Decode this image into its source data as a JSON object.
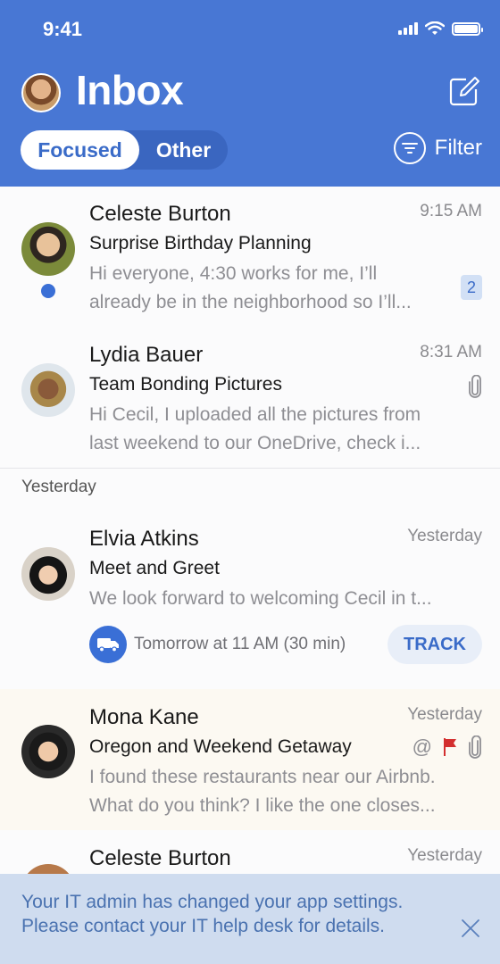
{
  "status_bar": {
    "time": "9:41"
  },
  "header": {
    "title": "Inbox",
    "tabs": [
      {
        "label": "Focused",
        "active": true
      },
      {
        "label": "Other",
        "active": false
      }
    ],
    "filter_label": "Filter"
  },
  "emails": [
    {
      "sender": "Celeste Burton",
      "time": "9:15 AM",
      "subject": "Surprise Birthday Planning",
      "preview_line1": "Hi everyone, 4:30 works for me, I’ll",
      "preview_line2": "already be in the neighborhood so I’ll...",
      "unread": true,
      "thread_count": "2"
    },
    {
      "sender": "Lydia Bauer",
      "time": "8:31 AM",
      "subject": "Team Bonding Pictures",
      "preview_line1": "Hi Cecil, I uploaded all the pictures from",
      "preview_line2": "last weekend to our OneDrive, check i...",
      "has_attachment": true
    }
  ],
  "section": {
    "label": "Yesterday"
  },
  "yesterday_emails": [
    {
      "sender": "Elvia Atkins",
      "time": "Yesterday",
      "subject": "Meet and Greet",
      "preview_line1": "We look forward to welcoming Cecil in t...",
      "delivery_text": "Tomorrow at 11 AM (30 min)",
      "track_label": "TRACK"
    },
    {
      "sender": "Mona Kane",
      "time": "Yesterday",
      "subject": "Oregon and Weekend Getaway",
      "preview_line1": "I found these restaurants near our Airbnb.",
      "preview_line2": "What do you think? I like the one closes...",
      "mention": "@",
      "flagged": true,
      "has_attachment": true
    },
    {
      "sender": "Celeste Burton",
      "time": "Yesterday"
    }
  ],
  "banner": {
    "message": "Your IT admin has changed your app settings. Please contact your IT help desk for details."
  },
  "colors": {
    "header_bg": "#4877d4",
    "accent": "#3a6fd6",
    "flag": "#d32f2f",
    "banner_bg": "#cfdcef"
  }
}
